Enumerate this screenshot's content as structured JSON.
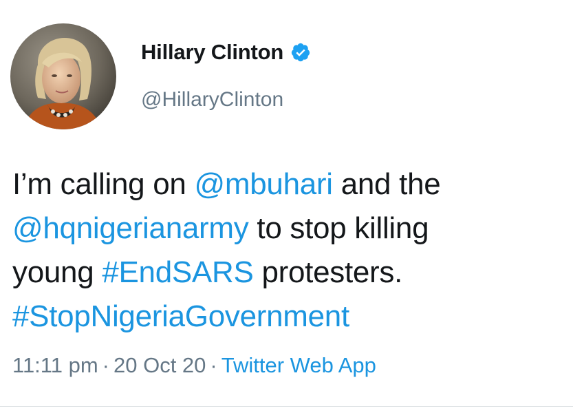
{
  "author": {
    "display_name": "Hillary Clinton",
    "handle": "@HillaryClinton",
    "verified_icon": "verified-badge-icon",
    "avatar": "profile-photo"
  },
  "tweet": {
    "text_intro": "I’m calling on",
    "mention_1": "@mbuhari",
    "text_and_the": "and the",
    "mention_2": "@hqnigerianarmy",
    "text_stop": "to stop killing",
    "text_young": "young",
    "hashtag_1": "#EndSARS",
    "text_protesters": "protesters.",
    "hashtag_2": "#StopNigeriaGovernment"
  },
  "meta": {
    "time": "11:11 pm",
    "separator": "·",
    "date": "20 Oct 20",
    "source": "Twitter Web App"
  },
  "colors": {
    "link": "#1b95e0",
    "text": "#14171a",
    "muted": "#657786",
    "verified": "#1da1f2"
  }
}
